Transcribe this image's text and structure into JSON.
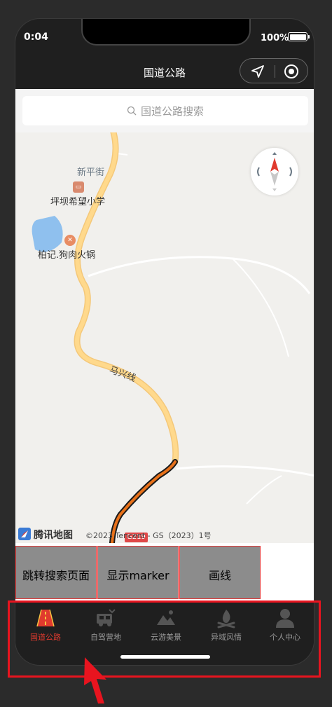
{
  "status_bar": {
    "time": "0:04",
    "battery": "100%"
  },
  "nav": {
    "title": "国道公路"
  },
  "search": {
    "placeholder": "国道公路搜索"
  },
  "map": {
    "labels": {
      "street": "新平街",
      "school": "坪坝希望小学",
      "restaurant": "柏记.狗肉火锅",
      "road": "马兴线",
      "highway": "G219"
    },
    "logo_text": "腾讯地图",
    "copyright": "©2023 Tencent - GS（2023）1号"
  },
  "buttons": [
    {
      "label": "跳转搜索页面"
    },
    {
      "label": "显示marker"
    },
    {
      "label": "画线"
    }
  ],
  "tabbar": {
    "items": [
      {
        "label": "国道公路",
        "icon": "road-icon",
        "active": true
      },
      {
        "label": "自驾营地",
        "icon": "camper-icon",
        "active": false
      },
      {
        "label": "云游美景",
        "icon": "mountain-icon",
        "active": false
      },
      {
        "label": "异域风情",
        "icon": "campfire-icon",
        "active": false
      },
      {
        "label": "个人中心",
        "icon": "person-icon",
        "active": false
      }
    ]
  },
  "colors": {
    "accent": "#e03a2e",
    "annotation": "#e8141f",
    "button_bg": "#8c8c8c",
    "road_main": "#ffd98c",
    "route": "#e8711a"
  }
}
